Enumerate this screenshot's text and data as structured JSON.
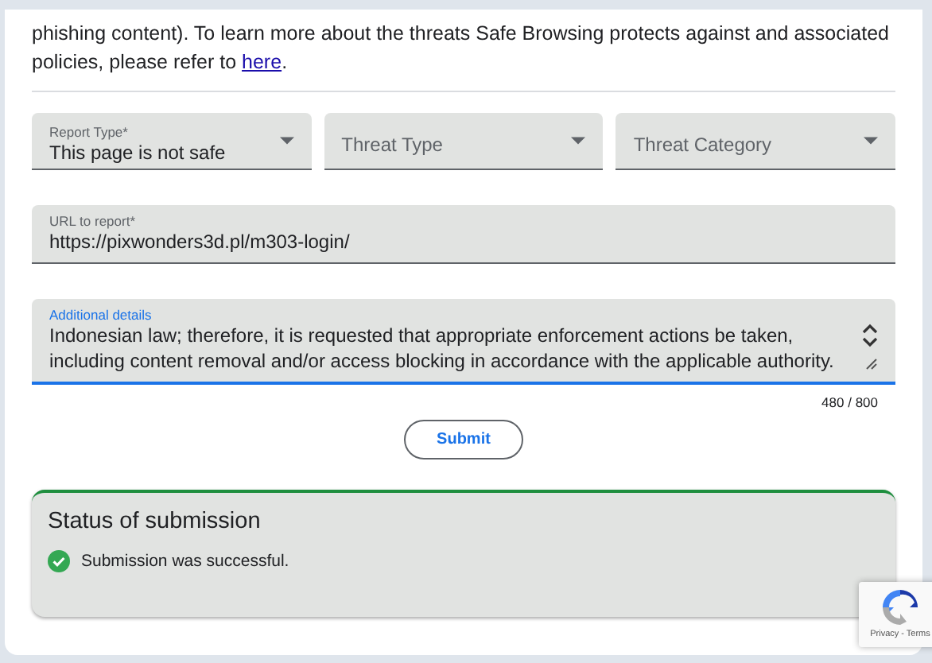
{
  "intro": {
    "text": "phishing content). To learn more about the threats Safe Browsing protects against and associated policies, please refer to",
    "link": "here",
    "after": "."
  },
  "selects": [
    {
      "label": "Report Type*",
      "value": "This page is not safe"
    },
    {
      "placeholder": "Threat Type"
    },
    {
      "placeholder": "Threat Category"
    }
  ],
  "url_field": {
    "label": "URL to report*",
    "value": "https://pixwonders3d.pl/m303-login/"
  },
  "details_field": {
    "label": "Additional details",
    "value": "Indonesian law; therefore, it is requested that appropriate enforcement actions be taken, including content removal and/or access blocking in accordance with the applicable authority.",
    "focused": true,
    "counter": "480 / 800"
  },
  "submit_button": "Submit",
  "status": {
    "title": "Status of submission",
    "message": "Submission was successful.",
    "success": true
  },
  "recaptcha": {
    "links": "Privacy - Terms"
  }
}
